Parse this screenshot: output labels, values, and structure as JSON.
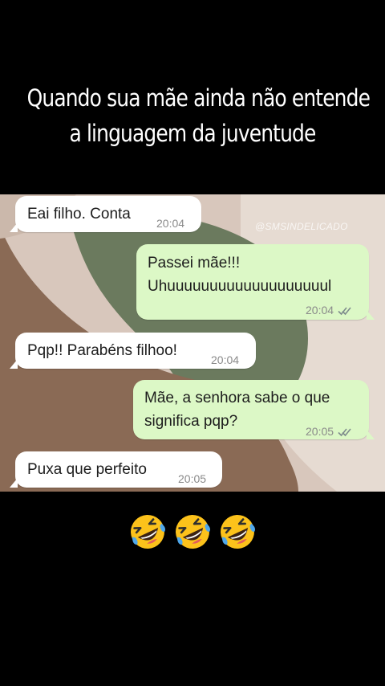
{
  "caption": {
    "line1": "Quando sua mãe ainda não entende",
    "line2": "a linguagem da juventude"
  },
  "watermark": "@SMSINDELICADO",
  "messages": [
    {
      "direction": "incoming",
      "text": "Eai filho. Conta",
      "time": "20:04"
    },
    {
      "direction": "outgoing",
      "lines": [
        "Passei mãe!!!",
        "Uhuuuuuuuuuuuuuuuuuuul"
      ],
      "time": "20:04",
      "status": "read"
    },
    {
      "direction": "incoming",
      "text": "Pqp!! Parabéns filhoo!",
      "time": "20:04"
    },
    {
      "direction": "outgoing",
      "lines": [
        "Mãe, a senhora sabe o que",
        "significa pqp?"
      ],
      "time": "20:05",
      "status": "read"
    },
    {
      "direction": "incoming",
      "text": "Puxa que perfeito",
      "time": "20:05"
    }
  ],
  "reaction_emojis": [
    "rolling-on-floor-laughing",
    "rolling-on-floor-laughing",
    "rolling-on-floor-laughing"
  ],
  "colors": {
    "page_background": "#000000",
    "chat_background": "#d8c7bc",
    "shape_olive": "#6b7a5e",
    "shape_brown": "#8a6a55",
    "incoming_bubble": "#ffffff",
    "outgoing_bubble": "#dcf8c6",
    "timestamp": "#8a8a8a"
  }
}
